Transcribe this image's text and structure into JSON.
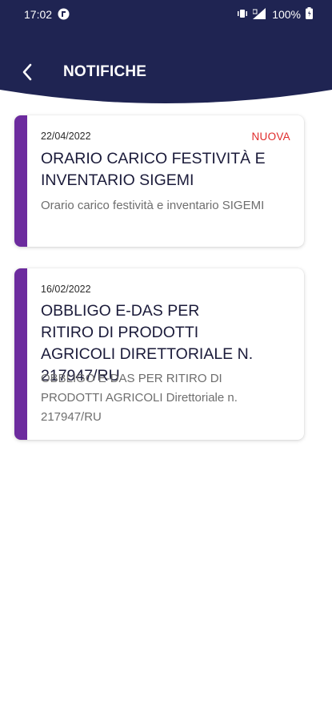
{
  "status_bar": {
    "time": "17:02",
    "battery": "100%"
  },
  "header": {
    "title": "NOTIFICHE",
    "background_color": "#1f2452"
  },
  "notifications": [
    {
      "date": "22/04/2022",
      "badge": "NUOVA",
      "title": "ORARIO CARICO FESTIVITÀ E INVENTARIO SIGEMI",
      "body": "Orario carico festività e inventario SIGEMI"
    },
    {
      "date": "16/02/2022",
      "badge": "",
      "title": "OBBLIGO E-DAS PER RITIRO DI PRODOTTI AGRICOLI DIRETTORIALE N. 217947/RU",
      "body": "OBBLIGO E-DAS PER RITIRO DI PRODOTTI AGRICOLI Direttoriale n. 217947/RU"
    }
  ],
  "colors": {
    "accent": "#6c2b9e",
    "badge": "#e02a2a"
  }
}
